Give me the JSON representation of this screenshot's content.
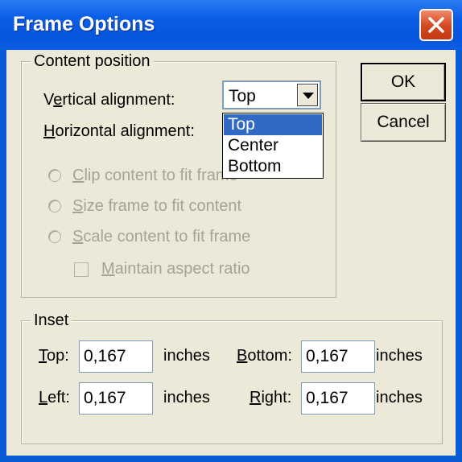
{
  "window": {
    "title": "Frame Options"
  },
  "buttons": {
    "ok": "OK",
    "cancel": "Cancel"
  },
  "content_position": {
    "title": "Content position",
    "vertical_label_prefix": "V",
    "vertical_label_underline": "e",
    "vertical_label_suffix": "rtical alignment:",
    "horizontal_label_underline": "H",
    "horizontal_label_suffix": "orizontal alignment:",
    "vertical_value": "Top",
    "dropdown_options": [
      "Top",
      "Center",
      "Bottom"
    ],
    "options": [
      {
        "underline": "C",
        "rest": "lip content to fit frame"
      },
      {
        "underline": "S",
        "rest": "ize frame to fit content"
      },
      {
        "underline": "S",
        "rest": "cale content to fit frame"
      }
    ],
    "checkbox": {
      "underline": "M",
      "rest": "aintain aspect ratio"
    }
  },
  "inset": {
    "title": "Inset",
    "unit": "inches",
    "fields": {
      "top": {
        "underline": "T",
        "rest": "op:",
        "value": "0,167"
      },
      "bottom": {
        "underline": "B",
        "rest": "ottom:",
        "value": "0,167"
      },
      "left": {
        "underline": "L",
        "rest": "eft:",
        "value": "0,167"
      },
      "right": {
        "underline": "R",
        "rest": "ight:",
        "value": "0,167"
      }
    }
  },
  "colors": {
    "title_bar": "#0b5ee6",
    "close_button": "#d2471f",
    "selection": "#316ac5",
    "dialog_face": "#ece9d8"
  }
}
